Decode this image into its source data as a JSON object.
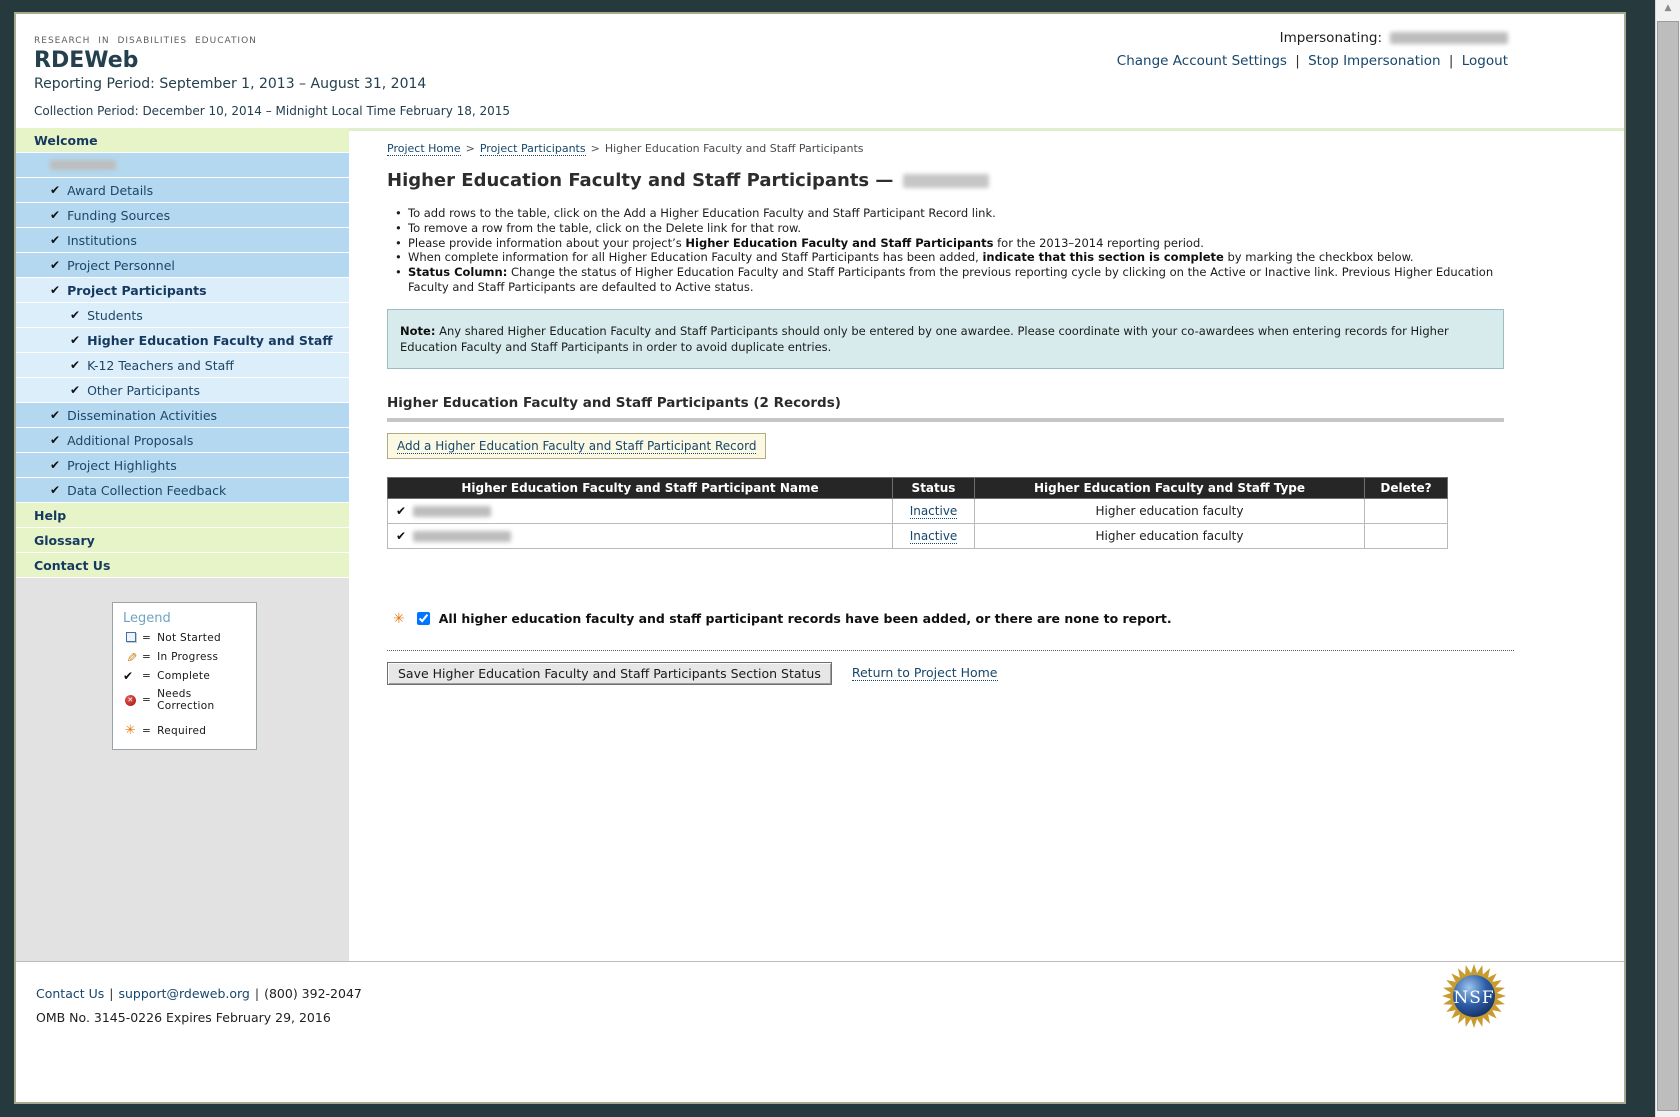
{
  "colors": {
    "frame": "#26393d",
    "sidebar_blue": "#b4d8ef",
    "sidebar_light_blue": "#ddeefb",
    "sidebar_green": "#e7f4c7",
    "note_background": "#d7ebec",
    "table_header_background": "#262626",
    "link": "#17466b",
    "required_orange": "#e2780c"
  },
  "header": {
    "eyebrow": "RESEARCH IN DISABILITIES EDUCATION",
    "app_title": "RDEWeb",
    "reporting_period": "Reporting Period: September 1, 2013 – August 31, 2014",
    "collection_period": "Collection Period: December 10, 2014 – Midnight Local Time February 18, 2015",
    "impersonating_label": "Impersonating:",
    "account_links": [
      "Change Account Settings",
      "Stop Impersonation",
      "Logout"
    ],
    "link_separator": "|"
  },
  "sidebar": {
    "items": [
      {
        "label": "Welcome",
        "style": "green",
        "indent": 0,
        "bold": true
      },
      {
        "redacted": true,
        "name": "award-number",
        "style": "blue",
        "indent": 1
      },
      {
        "label": "Award Details",
        "style": "blue",
        "indent": 1,
        "check": true
      },
      {
        "label": "Funding Sources",
        "style": "blue",
        "indent": 1,
        "check": true
      },
      {
        "label": "Institutions",
        "style": "blue",
        "indent": 1,
        "check": true
      },
      {
        "label": "Project Personnel",
        "style": "blue",
        "indent": 1,
        "check": true
      },
      {
        "label": "Project Participants",
        "style": "light",
        "indent": 1,
        "check": true,
        "bold": true
      },
      {
        "label": "Students",
        "style": "light",
        "indent": 2,
        "check": true
      },
      {
        "label": "Higher Education Faculty and Staff",
        "style": "light",
        "indent": 2,
        "check": true,
        "bold": true
      },
      {
        "label": "K-12 Teachers and Staff",
        "style": "light",
        "indent": 2,
        "check": true
      },
      {
        "label": "Other Participants",
        "style": "light",
        "indent": 2,
        "check": true
      },
      {
        "label": "Dissemination Activities",
        "style": "blue",
        "indent": 1,
        "check": true
      },
      {
        "label": "Additional Proposals",
        "style": "blue",
        "indent": 1,
        "check": true
      },
      {
        "label": "Project Highlights",
        "style": "blue",
        "indent": 1,
        "check": true
      },
      {
        "label": "Data Collection Feedback",
        "style": "blue",
        "indent": 1,
        "check": true
      },
      {
        "label": "Help",
        "style": "green",
        "indent": 0,
        "bold": true
      },
      {
        "label": "Glossary",
        "style": "green",
        "indent": 0,
        "bold": true
      },
      {
        "label": "Contact Us",
        "style": "green",
        "indent": 0,
        "bold": true
      }
    ]
  },
  "legend": {
    "title": "Legend",
    "equals": "=",
    "items": [
      {
        "icon": "not-started-square-icon",
        "label": "Not Started"
      },
      {
        "icon": "in-progress-pencil-icon",
        "label": "In Progress"
      },
      {
        "icon": "complete-check-icon",
        "label": "Complete"
      },
      {
        "icon": "needs-correction-icon",
        "label": "Needs Correction"
      },
      {
        "icon": "required-asterisk-icon",
        "label": "Required",
        "spaced": true
      }
    ]
  },
  "breadcrumb": {
    "separator": ">",
    "items": [
      {
        "label": "Project Home",
        "link": true
      },
      {
        "label": "Project Participants",
        "link": true
      },
      {
        "label": "Higher Education Faculty and Staff Participants",
        "link": false
      }
    ]
  },
  "main": {
    "title": "Higher Education Faculty and Staff Participants —",
    "bullets": [
      {
        "segments": [
          {
            "t": "To add rows to the table, click on the Add a Higher Education Faculty and Staff Participant Record link.",
            "b": false
          }
        ]
      },
      {
        "segments": [
          {
            "t": "To remove a row from the table, click on the Delete link for that row.",
            "b": false
          }
        ]
      },
      {
        "segments": [
          {
            "t": "Please provide information about your project’s ",
            "b": false
          },
          {
            "t": "Higher Education Faculty and Staff Participants",
            "b": true
          },
          {
            "t": " for the 2013–2014 reporting period.",
            "b": false
          }
        ]
      },
      {
        "segments": [
          {
            "t": "When complete information for all Higher Education Faculty and Staff Participants has been added, ",
            "b": false
          },
          {
            "t": "indicate that this section is complete",
            "b": true
          },
          {
            "t": " by marking the checkbox below.",
            "b": false
          }
        ]
      },
      {
        "segments": [
          {
            "t": "Status Column:",
            "b": true
          },
          {
            "t": " Change the status of Higher Education Faculty and Staff Participants from the previous reporting cycle by clicking on the Active or Inactive link. Previous Higher Education Faculty and Staff Participants are defaulted to Active status.",
            "b": false
          }
        ]
      }
    ],
    "note": {
      "label": "Note:",
      "text": " Any shared Higher Education Faculty and Staff Participants should only be entered by one awardee. Please coordinate with your co-awardees when entering records for Higher Education Faculty and Staff Participants in order to avoid duplicate entries."
    },
    "section_heading": "Higher Education Faculty and Staff Participants (2 Records)",
    "add_record_link": "Add a Higher Education Faculty and Staff Participant Record",
    "table": {
      "columns": [
        "Higher Education Faculty and Staff Participant Name",
        "Status",
        "Higher Education Faculty and Staff Type",
        "Delete?"
      ],
      "rows": [
        {
          "name_redacted": true,
          "status": "Inactive",
          "type": "Higher education faculty",
          "delete": ""
        },
        {
          "name_redacted": true,
          "status": "Inactive",
          "type": "Higher education faculty",
          "delete": ""
        }
      ]
    },
    "completion": {
      "checked": true,
      "label": "All higher education faculty and staff participant records have been added, or there are none to report."
    },
    "save_button": "Save Higher Education Faculty and Staff Participants Section Status",
    "return_link": "Return to Project Home"
  },
  "footer": {
    "links": [
      "Contact Us",
      "support@rdeweb.org"
    ],
    "phone": "(800) 392-2047",
    "separator": "|",
    "omb": "OMB No. 3145-0226 Expires February 29, 2016",
    "nsf_logo_text": "NSF"
  }
}
